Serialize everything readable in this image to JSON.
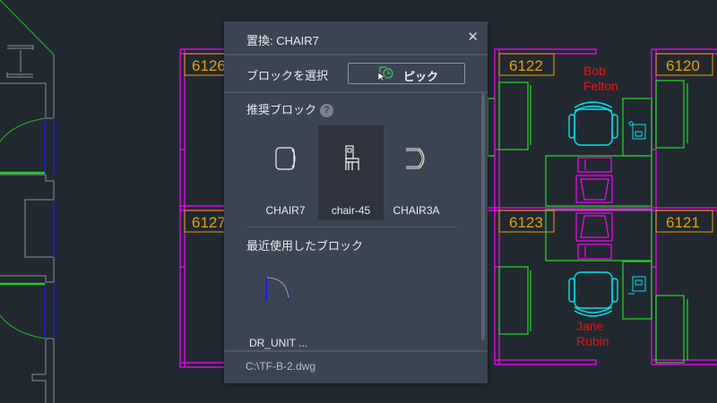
{
  "drawing": {
    "rooms": [
      "6122",
      "6120",
      "6123",
      "6121",
      "6126",
      "6127"
    ],
    "occupants": [
      [
        "Bob",
        "Felton"
      ],
      [
        "Jane",
        "Rubin"
      ]
    ],
    "colors": {
      "wall": "#ff00ff",
      "furniture": "#00dd00",
      "label": "#e8a000",
      "chair": "#00e5ee",
      "name": "#ee1111"
    }
  },
  "dialog": {
    "title": "置換: CHAIR7",
    "close_icon": "close-icon",
    "select_label": "ブロックを選択",
    "pick_label": "ピック",
    "recommended_label": "推奨ブロック",
    "help": "?",
    "recommended": [
      {
        "name": "CHAIR7"
      },
      {
        "name": "chair-45"
      },
      {
        "name": "CHAIR3A"
      }
    ],
    "recent_label": "最近使用したブロック",
    "recent": [
      {
        "name": "DR_UNIT ..."
      }
    ],
    "file_path": "C:\\TF-B-2.dwg"
  }
}
